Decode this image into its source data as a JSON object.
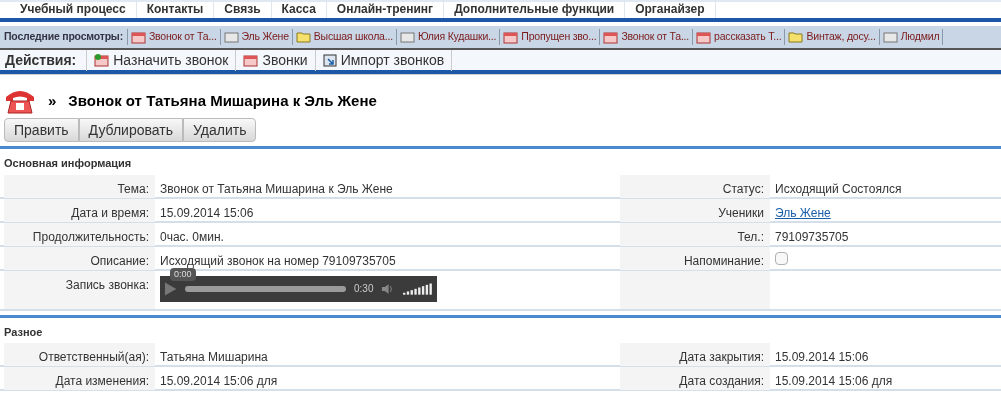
{
  "nav": [
    "Учебный процесс",
    "Контакты",
    "Связь",
    "Касса",
    "Онлайн-тренинг",
    "Дополнительные функции",
    "Органайзер"
  ],
  "recent": {
    "label": "Последние просмотры:",
    "items": [
      {
        "kind": "call",
        "text": "Звонок от Та..."
      },
      {
        "kind": "contact",
        "text": "Эль Жене"
      },
      {
        "kind": "folder",
        "text": "Высшая школа..."
      },
      {
        "kind": "contact",
        "text": "Юлия Кудашки..."
      },
      {
        "kind": "call",
        "text": "Пропущен зво..."
      },
      {
        "kind": "call",
        "text": "Звонок от Та..."
      },
      {
        "kind": "call",
        "text": "рассказать Т..."
      },
      {
        "kind": "folder",
        "text": "Винтаж, досу..."
      },
      {
        "kind": "contact",
        "text": "Людмил"
      }
    ]
  },
  "actions": {
    "label": "Действия:",
    "items": [
      {
        "kind": "new-call",
        "text": "Назначить звонок"
      },
      {
        "kind": "call",
        "text": "Звонки"
      },
      {
        "kind": "import",
        "text": "Импорт звонков"
      }
    ]
  },
  "record": {
    "separator": "»",
    "title": "Звонок от Татьяна Мишарина к Эль Жене",
    "buttons": [
      "Править",
      "Дублировать",
      "Удалить"
    ]
  },
  "sections": [
    {
      "title": "Основная информация",
      "rows": [
        {
          "left": {
            "label": "Тема:",
            "kind": "text",
            "value": "Звонок от Татьяна Мишарина к Эль Жене"
          },
          "right": {
            "label": "Статус:",
            "kind": "text",
            "value": "Исходящий Состоялся"
          }
        },
        {
          "left": {
            "label": "Дата и время:",
            "kind": "text",
            "value": "15.09.2014 15:06"
          },
          "right": {
            "label": "Ученики",
            "kind": "link",
            "value": "Эль Жене"
          }
        },
        {
          "left": {
            "label": "Продолжительность:",
            "kind": "text",
            "value": "0час. 0мин."
          },
          "right": {
            "label": "Тел.:",
            "kind": "text",
            "value": "79109735705"
          }
        },
        {
          "left": {
            "label": "Описание:",
            "kind": "text",
            "value": "Исходящий звонок на номер 79109735705"
          },
          "right": {
            "label": "Напоминание:",
            "kind": "checkbox",
            "checked": false
          }
        },
        {
          "left": {
            "label": "Запись звонка:",
            "kind": "audio",
            "tooltip": "0:00",
            "duration": "0:30"
          },
          "right": {
            "kind": "empty"
          }
        }
      ]
    },
    {
      "title": "Разное",
      "rows": [
        {
          "left": {
            "label": "Ответственный(ая):",
            "kind": "text",
            "value": "Татьяна Мишарина"
          },
          "right": {
            "label": "Дата закрытия:",
            "kind": "text",
            "value": "15.09.2014 15:06"
          }
        },
        {
          "left": {
            "label": "Дата изменения:",
            "kind": "text",
            "value": "15.09.2014 15:06 для"
          },
          "right": {
            "label": "Дата создания:",
            "kind": "text",
            "value": "15.09.2014 15:06 для"
          }
        }
      ]
    }
  ]
}
